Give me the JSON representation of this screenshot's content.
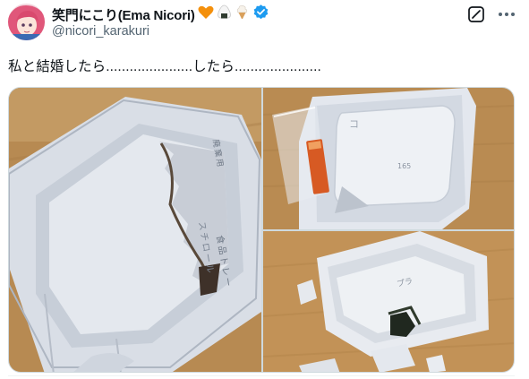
{
  "tweet": {
    "author": {
      "display_name": "笑門にこり(Ema Nicori)",
      "emojis": [
        "orange-heart",
        "rice-ball",
        "soft-serve"
      ],
      "handle": "@nicori_karakuri",
      "verified": true
    },
    "text": "私と結婚したら......................したら......................",
    "media": [
      {
        "name": "broken-foam-tray-closeup",
        "tray_labels": [
          "スチロール",
          "食品トレー",
          "廃棄用"
        ]
      },
      {
        "name": "natto-container-with-sauce",
        "tray_labels": [
          "コ",
          "165"
        ]
      },
      {
        "name": "broken-natto-container",
        "tray_labels": [
          "プラ"
        ]
      }
    ]
  },
  "colors": {
    "text_primary": "#0f1419",
    "text_secondary": "#536471",
    "verified_blue": "#1d9bf0",
    "border": "#cfd9de",
    "wood": "#b9894d"
  }
}
